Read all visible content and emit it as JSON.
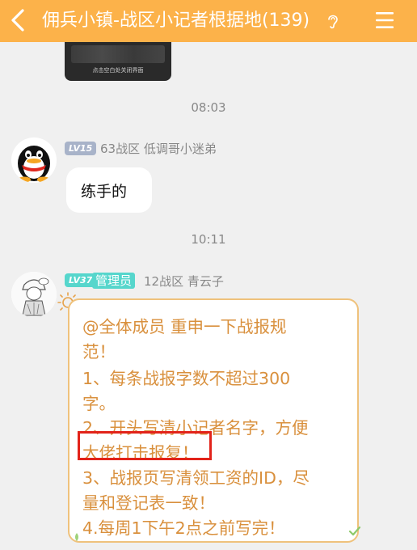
{
  "header": {
    "title": "佣兵小镇-战区小记者根据地(139)",
    "back_icon": "chevron-left-icon",
    "ear_icon": "ear-icon",
    "menu_icon": "hamburger-menu-icon",
    "bg_color": "#fcb24a"
  },
  "image_message": {
    "caption": "点击空白处关闭界面"
  },
  "timestamps": [
    "08:03",
    "10:11"
  ],
  "messages": [
    {
      "level": "LV15",
      "sender": "63战区 低调哥小迷弟",
      "text": "练手的"
    },
    {
      "level": "LV37",
      "role": "管理员",
      "sender": "12战区 青云子",
      "lines": [
        "@全体成员 重申一下战报规",
        "范！",
        "1、每条战报字数不超过300",
        "字。",
        "2、开头写清小记者名字，方便",
        "大佬打击报复！",
        "3、战报页写清领工资的ID，尽",
        "量和登记表一致！",
        "4.每周1下午2点之前写完！"
      ]
    }
  ],
  "colors": {
    "notice_text": "#d9903d",
    "notice_border": "#efc27c",
    "highlight_border": "#e2231a",
    "admin_badge": "#56d6cc"
  }
}
